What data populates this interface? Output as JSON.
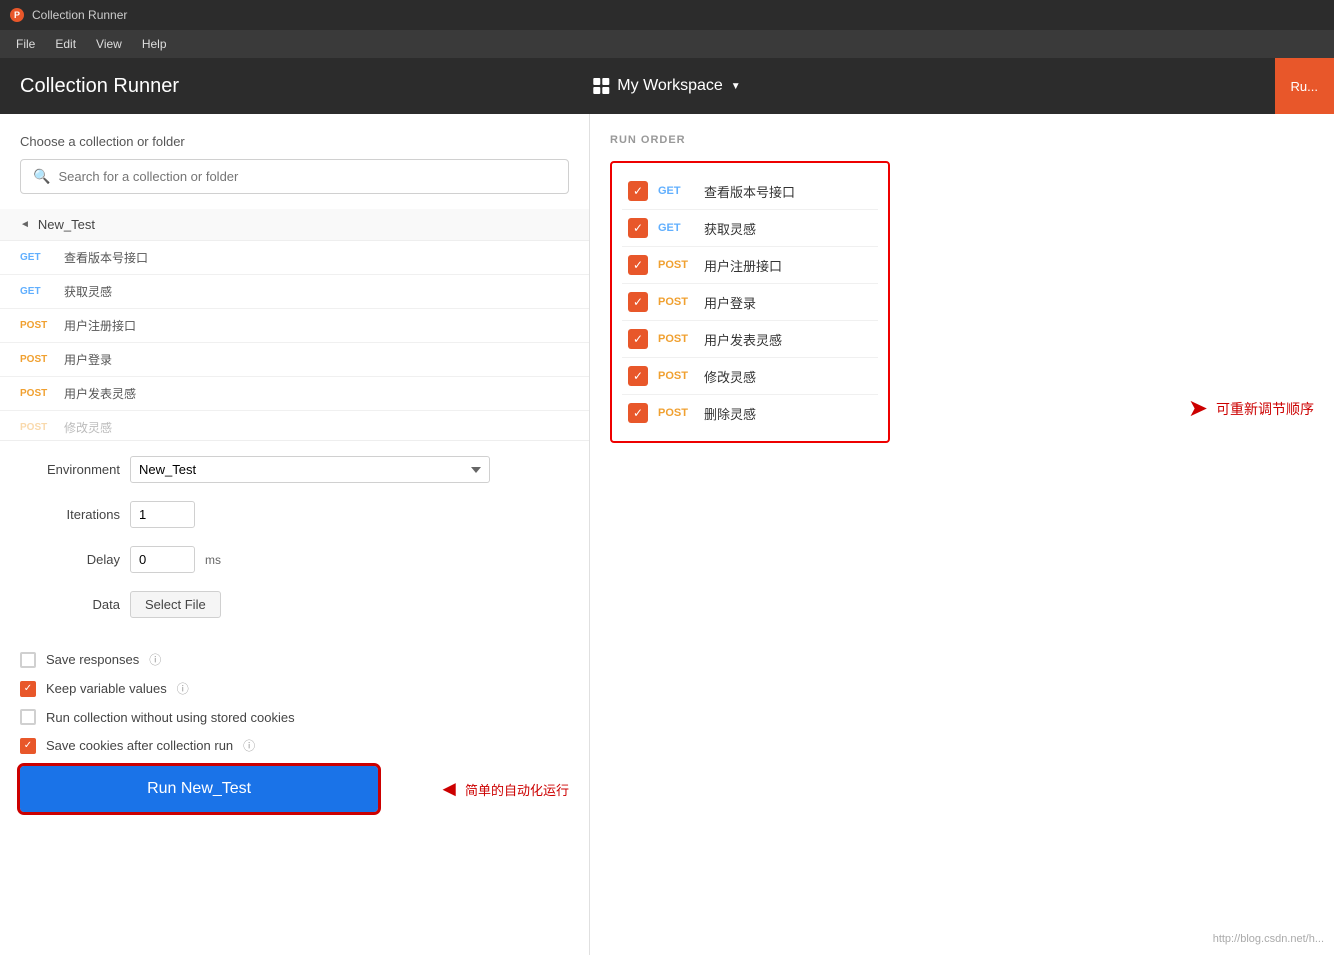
{
  "titlebar": {
    "icon": "🔶",
    "title": "Collection Runner"
  },
  "menubar": {
    "items": [
      "File",
      "Edit",
      "View",
      "Help"
    ]
  },
  "header": {
    "title": "Collection Runner",
    "workspace_label": "My Workspace",
    "run_label": "Ru..."
  },
  "left": {
    "choose_label": "Choose a collection or folder",
    "search_placeholder": "Search for a collection or folder",
    "collection_name": "New_Test",
    "requests": [
      {
        "method": "GET",
        "name": "查看版本号接口"
      },
      {
        "method": "GET",
        "name": "获取灵感"
      },
      {
        "method": "POST",
        "name": "用户注册接口"
      },
      {
        "method": "POST",
        "name": "用户登录"
      },
      {
        "method": "POST",
        "name": "用户发表灵感"
      },
      {
        "method": "POST",
        "name": "修改灵感"
      }
    ],
    "env_label": "Environment",
    "env_value": "New_Test",
    "iterations_label": "Iterations",
    "iterations_value": "1",
    "delay_label": "Delay",
    "delay_value": "0",
    "delay_unit": "ms",
    "data_label": "Data",
    "select_file_label": "Select File",
    "save_responses_label": "Save responses",
    "keep_variable_label": "Keep variable values",
    "run_without_cookies_label": "Run collection without using stored cookies",
    "save_cookies_label": "Save cookies after collection run",
    "run_button_label": "Run New_Test"
  },
  "right": {
    "run_order_title": "RUN ORDER",
    "items": [
      {
        "method": "GET",
        "name": "查看版本号接口"
      },
      {
        "method": "GET",
        "name": "获取灵感"
      },
      {
        "method": "POST",
        "name": "用户注册接口"
      },
      {
        "method": "POST",
        "name": "用户登录"
      },
      {
        "method": "POST",
        "name": "用户发表灵感"
      },
      {
        "method": "POST",
        "name": "修改灵感"
      },
      {
        "method": "POST",
        "name": "删除灵感"
      }
    ],
    "annotation_order": "可重新调节顺序",
    "annotation_auto": "简单的自动化运行",
    "watermark": "http://blog.csdn.net/h..."
  }
}
